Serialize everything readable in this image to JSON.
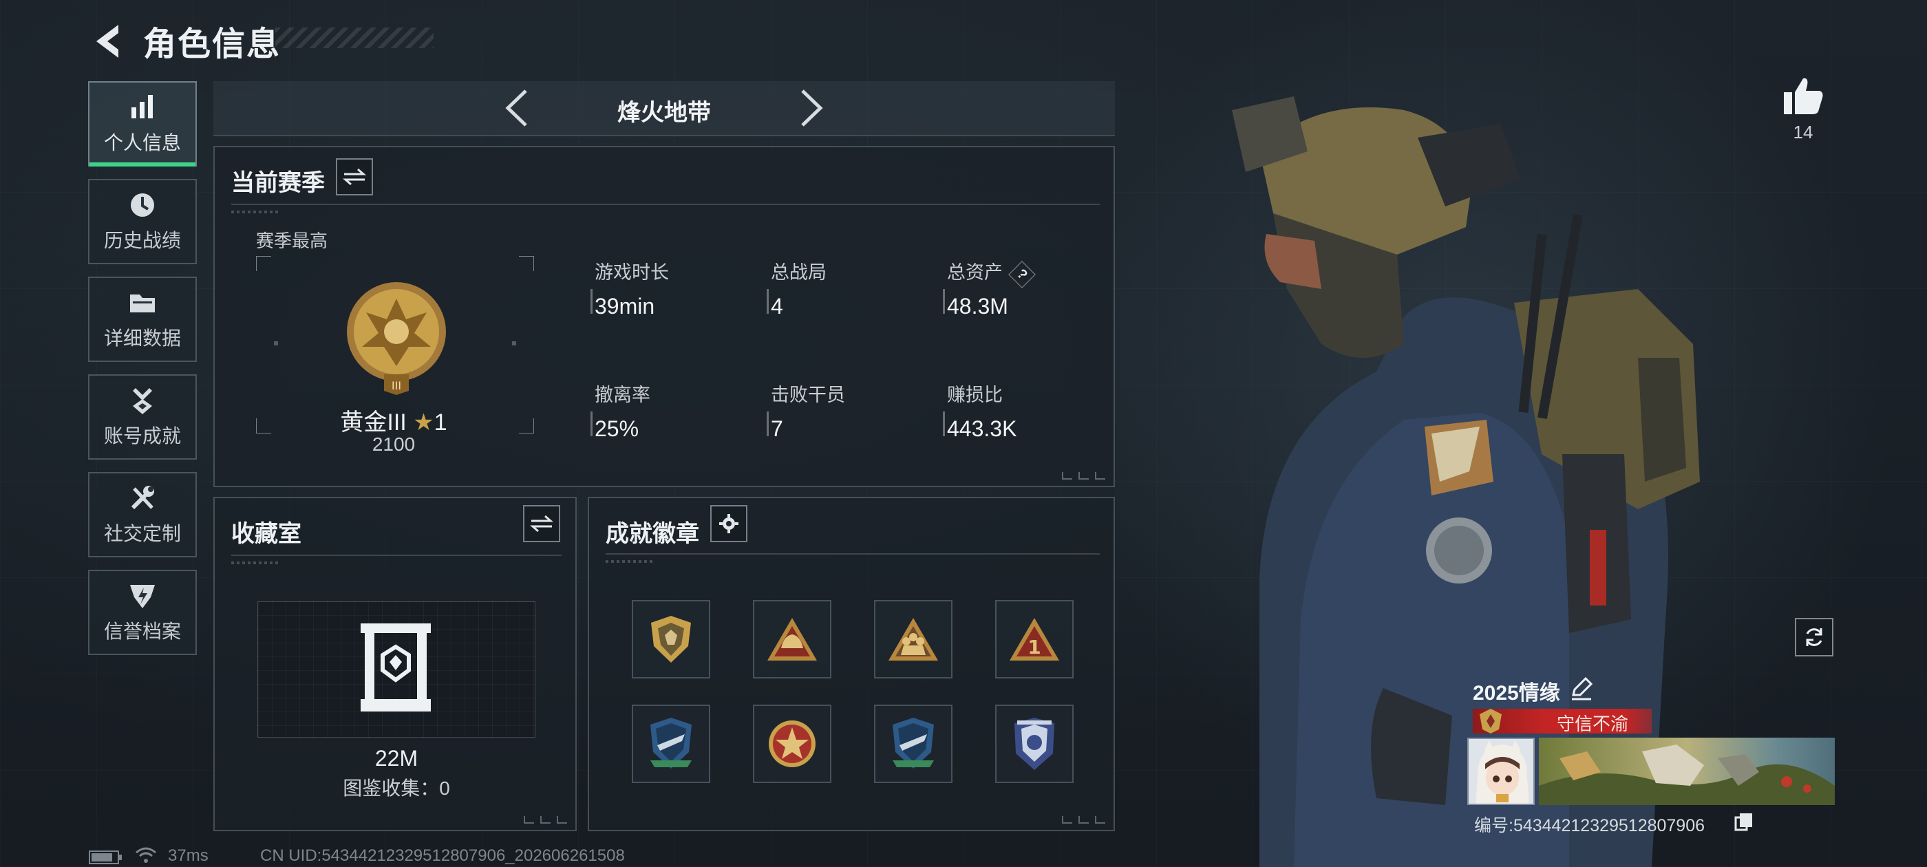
{
  "header": {
    "title": "角色信息"
  },
  "sidebar": {
    "items": [
      {
        "label": "个人信息",
        "icon": "bar-chart-icon",
        "active": true
      },
      {
        "label": "历史战绩",
        "icon": "history-clock-icon"
      },
      {
        "label": "详细数据",
        "icon": "folder-icon"
      },
      {
        "label": "账号成就",
        "icon": "achievement-medal-icon"
      },
      {
        "label": "社交定制",
        "icon": "wrench-tools-icon"
      },
      {
        "label": "信誉档案",
        "icon": "credit-shield-icon"
      }
    ]
  },
  "mode": {
    "title": "烽火地带"
  },
  "season": {
    "title": "当前赛季",
    "best_label": "赛季最高",
    "rank_name": "黄金III",
    "rank_stars": "1",
    "rank_score": "2100",
    "stats": [
      {
        "label": "游戏时长",
        "value": "39min"
      },
      {
        "label": "总战局",
        "value": "4"
      },
      {
        "label": "总资产",
        "value": "48.3M",
        "help": "?"
      },
      {
        "label": "撤离率",
        "value": "25%"
      },
      {
        "label": "击败干员",
        "value": "7"
      },
      {
        "label": "赚损比",
        "value": "443.3K"
      }
    ]
  },
  "collection": {
    "title": "收藏室",
    "value": "22M",
    "catalog_text": "图鉴收集：0"
  },
  "badges": {
    "title": "成就徽章",
    "items": [
      "shield-badge-icon",
      "triangle-helmet-badge-icon",
      "triangle-squad-badge-icon",
      "triangle-number-one-badge-icon",
      "blue-wing-shield-badge-icon",
      "red-star-medal-badge-icon",
      "blue-wing-shield-badge-icon",
      "blue-police-shield-badge-icon"
    ]
  },
  "likes": {
    "count": "14"
  },
  "card": {
    "title": "2025情缘",
    "honor": "守信不渝",
    "player_id": "编号:5434421232951280790​6"
  },
  "footer": {
    "ping": "37ms",
    "uid": "CN UID:5434421232951280790​6_202606261508"
  },
  "colors": {
    "accent": "#3ed38a",
    "honor": "#c42424",
    "gold": "#c9a14a"
  }
}
